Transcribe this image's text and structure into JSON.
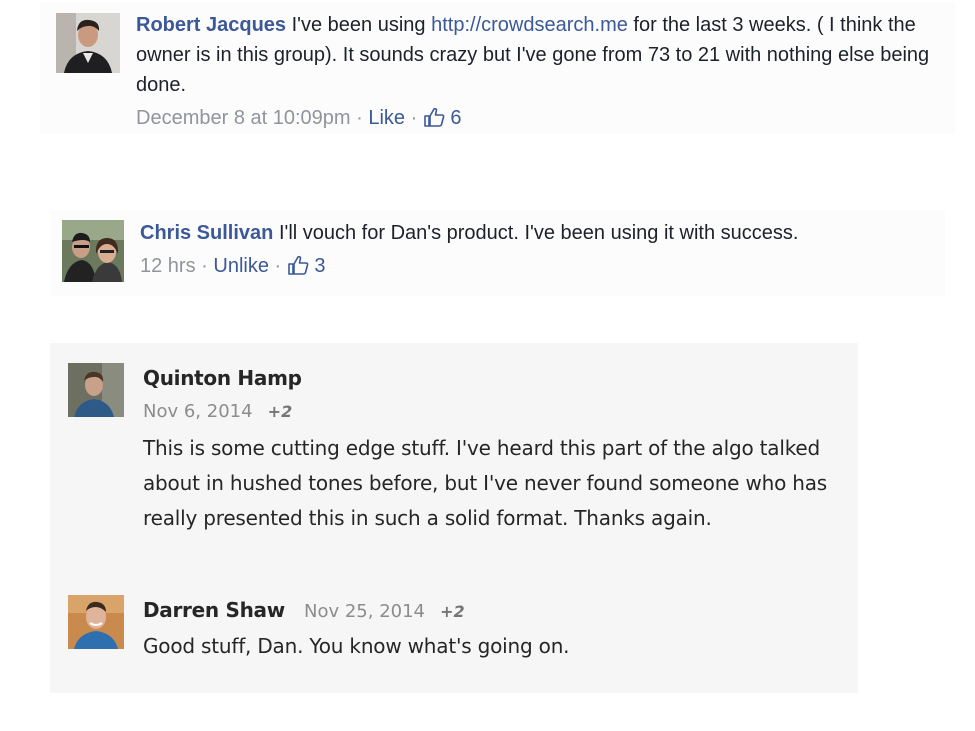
{
  "colors": {
    "fb_link": "#3b5998",
    "fb_meta": "#90949c",
    "gp_panel": "#f6f6f6",
    "gp_text": "#262626"
  },
  "facebook_comments": [
    {
      "author": "Robert Jacques",
      "text_before_link": "I've been using",
      "link": "http://crowdsearch.me",
      "text_after_link": "for the last 3 weeks. ( I think the owner is in this group). It sounds crazy but I've gone from 73 to 21 with nothing else being done.",
      "timestamp": "December 8 at 10:09pm",
      "separator": "·",
      "action": "Like",
      "like_icon": "thumbs-up-icon",
      "like_count": "6"
    },
    {
      "author": "Chris Sullivan",
      "text": "I'll vouch for Dan's product. I've been using it with success.",
      "timestamp": "12 hrs",
      "separator": "·",
      "action": "Unlike",
      "like_icon": "thumbs-up-icon",
      "like_count": "3"
    }
  ],
  "gplus_comments": [
    {
      "author": "Quinton Hamp",
      "date": "Nov 6, 2014",
      "plus_count": "+2",
      "text": "This is some cutting edge stuff. I've heard this part of the algo talked about in hushed tones before, but I've never found someone who has really presented this in such a solid format. Thanks again."
    },
    {
      "author": "Darren Shaw",
      "date": "Nov 25, 2014",
      "plus_count": "+2",
      "text": "Good stuff, Dan. You know what's going on."
    }
  ]
}
